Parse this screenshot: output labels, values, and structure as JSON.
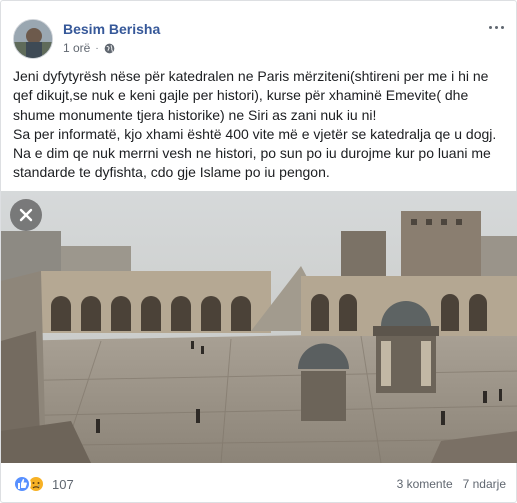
{
  "post": {
    "author": "Besim Berisha",
    "time": "1 orë",
    "separator": "·",
    "privacy_icon": "globe-icon",
    "more_icon": "more-options-icon",
    "text_lines": [
      "Jeni dyfytyrësh nëse për katedralen ne Paris mërziteni(shtireni per me i hi ne qef dikujt,se nuk e keni gajle per histori), kurse për xhaminë Emevite( dhe shume monumente tjera historike) ne Siri as zani nuk iu ni!",
      "Sa per informatë, kjo xhami është 400 vite më e vjetër se katedralja qe u dogj.",
      "Na e dim qe nuk merrni vesh ne histori, po sun po iu durojme kur po luani me standarde te dyfishta, cdo gje Islame po iu pengon."
    ],
    "photo_description_icon": "close-icon"
  },
  "footer": {
    "reaction_count": "107",
    "comments": "3 komente",
    "shares": "7 ndarje"
  },
  "colors": {
    "author_link": "#365899",
    "meta_text": "#606770",
    "like": "#5890ff",
    "sad": "#f7b125"
  }
}
